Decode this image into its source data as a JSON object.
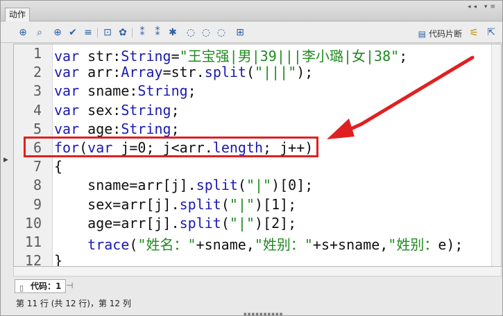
{
  "panel": {
    "title": "动作",
    "window_controls": "◂◂ ▾≡"
  },
  "toolbar": {
    "icons": [
      "add-icon",
      "find-icon",
      "target-icon",
      "check-syntax-icon",
      "auto-format-icon",
      "code-hint-icon",
      "debug-icon",
      "collapse-braces-icon",
      "collapse-selection-icon",
      "expand-all-icon",
      "apply-block-comment-icon",
      "apply-line-comment-icon",
      "remove-comment-icon",
      "script-assist-icon"
    ],
    "snippets_label": "代码片断"
  },
  "editor": {
    "line_numbers": [
      "1",
      "2",
      "3",
      "4",
      "5",
      "6",
      "7",
      "8",
      "9",
      "10",
      "11",
      "12"
    ],
    "lines": [
      [
        {
          "t": "var",
          "c": "kw"
        },
        {
          "t": " str:",
          "c": ""
        },
        {
          "t": "String",
          "c": "kw"
        },
        {
          "t": "=",
          "c": ""
        },
        {
          "t": "\"王宝强|男|39|||李小璐|女|38\"",
          "c": "str"
        },
        {
          "t": ";",
          "c": ""
        }
      ],
      [
        {
          "t": "var",
          "c": "kw"
        },
        {
          "t": " arr:",
          "c": ""
        },
        {
          "t": "Array",
          "c": "kw"
        },
        {
          "t": "=str.",
          "c": ""
        },
        {
          "t": "split",
          "c": "kw"
        },
        {
          "t": "(",
          "c": ""
        },
        {
          "t": "\"|||\"",
          "c": "str"
        },
        {
          "t": ");",
          "c": ""
        }
      ],
      [
        {
          "t": "var",
          "c": "kw"
        },
        {
          "t": " sname:",
          "c": ""
        },
        {
          "t": "String",
          "c": "kw"
        },
        {
          "t": ";",
          "c": ""
        }
      ],
      [
        {
          "t": "var",
          "c": "kw"
        },
        {
          "t": " sex:",
          "c": ""
        },
        {
          "t": "String",
          "c": "kw"
        },
        {
          "t": ";",
          "c": ""
        }
      ],
      [
        {
          "t": "var",
          "c": "kw"
        },
        {
          "t": " age:",
          "c": ""
        },
        {
          "t": "String",
          "c": "kw"
        },
        {
          "t": ";",
          "c": ""
        }
      ],
      [
        {
          "t": "for",
          "c": "kw"
        },
        {
          "t": "(",
          "c": ""
        },
        {
          "t": "var",
          "c": "kw"
        },
        {
          "t": " j=0; j<arr.",
          "c": ""
        },
        {
          "t": "length",
          "c": "kw"
        },
        {
          "t": "; j++)",
          "c": ""
        }
      ],
      [
        {
          "t": "{",
          "c": ""
        }
      ],
      [
        {
          "t": "    sname=arr[j].",
          "c": ""
        },
        {
          "t": "split",
          "c": "kw"
        },
        {
          "t": "(",
          "c": ""
        },
        {
          "t": "\"|\"",
          "c": "str"
        },
        {
          "t": ")[0];",
          "c": ""
        }
      ],
      [
        {
          "t": "    sex=arr[j].",
          "c": ""
        },
        {
          "t": "split",
          "c": "kw"
        },
        {
          "t": "(",
          "c": ""
        },
        {
          "t": "\"|\"",
          "c": "str"
        },
        {
          "t": ")[1];",
          "c": ""
        }
      ],
      [
        {
          "t": "    age=arr[j].",
          "c": ""
        },
        {
          "t": "split",
          "c": "kw"
        },
        {
          "t": "(",
          "c": ""
        },
        {
          "t": "\"|\"",
          "c": "str"
        },
        {
          "t": ")[2];",
          "c": ""
        }
      ],
      [
        {
          "t": "    ",
          "c": ""
        },
        {
          "t": "trace",
          "c": "kw"
        },
        {
          "t": "(",
          "c": ""
        },
        {
          "t": "\"姓名：\"",
          "c": "str"
        },
        {
          "t": "+sname,",
          "c": ""
        },
        {
          "t": "\"姓别：\"",
          "c": "str"
        },
        {
          "t": "+s+sname,",
          "c": ""
        },
        {
          "t": "\"姓别：",
          "c": "str"
        },
        {
          "t": "e);",
          "c": ""
        }
      ],
      [
        {
          "t": "}",
          "c": ""
        }
      ]
    ],
    "highlighted_line": "6"
  },
  "tabs": {
    "code_tab_label": "代码：1"
  },
  "status": {
    "text": "第 11 行 (共 12 行)，第 12 列"
  },
  "colors": {
    "keyword": "#1a1ab0",
    "string": "#1f8a1f",
    "annotation": "#e02020"
  }
}
